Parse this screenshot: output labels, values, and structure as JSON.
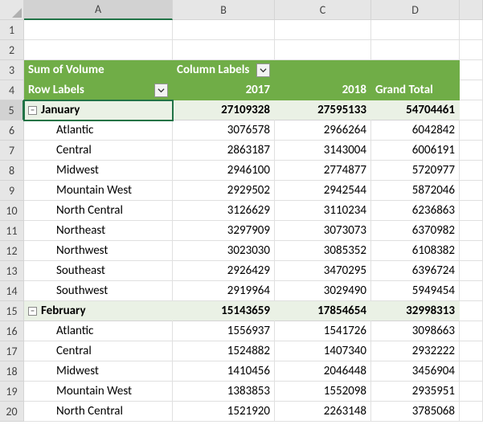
{
  "columns": [
    "A",
    "B",
    "C",
    "D",
    ""
  ],
  "rows": [
    "1",
    "2",
    "3",
    "4",
    "5",
    "6",
    "7",
    "8",
    "9",
    "10",
    "11",
    "12",
    "13",
    "14",
    "15",
    "16",
    "17",
    "18",
    "19",
    "20"
  ],
  "activeRow": 5,
  "activeCol": 1,
  "piv": {
    "row3": {
      "a": "Sum of Volume",
      "b": "Column Labels"
    },
    "row4": {
      "a": "Row Labels",
      "b": "2017",
      "c": "2018",
      "d": "Grand Total"
    }
  },
  "groups": [
    {
      "label": "January",
      "v2017": "27109328",
      "v2018": "27595133",
      "total": "54704461",
      "rows": [
        {
          "label": "Atlantic",
          "v2017": "3076578",
          "v2018": "2966264",
          "total": "6042842"
        },
        {
          "label": "Central",
          "v2017": "2863187",
          "v2018": "3143004",
          "total": "6006191"
        },
        {
          "label": "Midwest",
          "v2017": "2946100",
          "v2018": "2774877",
          "total": "5720977"
        },
        {
          "label": "Mountain West",
          "v2017": "2929502",
          "v2018": "2942544",
          "total": "5872046"
        },
        {
          "label": "North Central",
          "v2017": "3126629",
          "v2018": "3110234",
          "total": "6236863"
        },
        {
          "label": "Northeast",
          "v2017": "3297909",
          "v2018": "3073073",
          "total": "6370982"
        },
        {
          "label": "Northwest",
          "v2017": "3023030",
          "v2018": "3085352",
          "total": "6108382"
        },
        {
          "label": "Southeast",
          "v2017": "2926429",
          "v2018": "3470295",
          "total": "6396724"
        },
        {
          "label": "Southwest",
          "v2017": "2919964",
          "v2018": "3029490",
          "total": "5949454"
        }
      ]
    },
    {
      "label": "February",
      "v2017": "15143659",
      "v2018": "17854654",
      "total": "32998313",
      "rows": [
        {
          "label": "Atlantic",
          "v2017": "1556937",
          "v2018": "1541726",
          "total": "3098663"
        },
        {
          "label": "Central",
          "v2017": "1524882",
          "v2018": "1407340",
          "total": "2932222"
        },
        {
          "label": "Midwest",
          "v2017": "1410456",
          "v2018": "2046448",
          "total": "3456904"
        },
        {
          "label": "Mountain West",
          "v2017": "1383853",
          "v2018": "1552098",
          "total": "2935951"
        },
        {
          "label": "North Central",
          "v2017": "1521920",
          "v2018": "2263148",
          "total": "3785068"
        }
      ]
    }
  ],
  "icons": {
    "minus": "−"
  },
  "chart_data": {
    "type": "table",
    "title": "Sum of Volume",
    "columns": [
      "Row Labels",
      "2017",
      "2018",
      "Grand Total"
    ],
    "data": [
      [
        "January",
        27109328,
        27595133,
        54704461
      ],
      [
        "  Atlantic",
        3076578,
        2966264,
        6042842
      ],
      [
        "  Central",
        2863187,
        3143004,
        6006191
      ],
      [
        "  Midwest",
        2946100,
        2774877,
        5720977
      ],
      [
        "  Mountain West",
        2929502,
        2942544,
        5872046
      ],
      [
        "  North Central",
        3126629,
        3110234,
        6236863
      ],
      [
        "  Northeast",
        3297909,
        3073073,
        6370982
      ],
      [
        "  Northwest",
        3023030,
        3085352,
        6108382
      ],
      [
        "  Southeast",
        2926429,
        3470295,
        6396724
      ],
      [
        "  Southwest",
        2919964,
        3029490,
        5949454
      ],
      [
        "February",
        15143659,
        17854654,
        32998313
      ],
      [
        "  Atlantic",
        1556937,
        1541726,
        3098663
      ],
      [
        "  Central",
        1524882,
        1407340,
        2932222
      ],
      [
        "  Midwest",
        1410456,
        2046448,
        3456904
      ],
      [
        "  Mountain West",
        1383853,
        1552098,
        2935951
      ],
      [
        "  North Central",
        1521920,
        2263148,
        3785068
      ]
    ]
  }
}
